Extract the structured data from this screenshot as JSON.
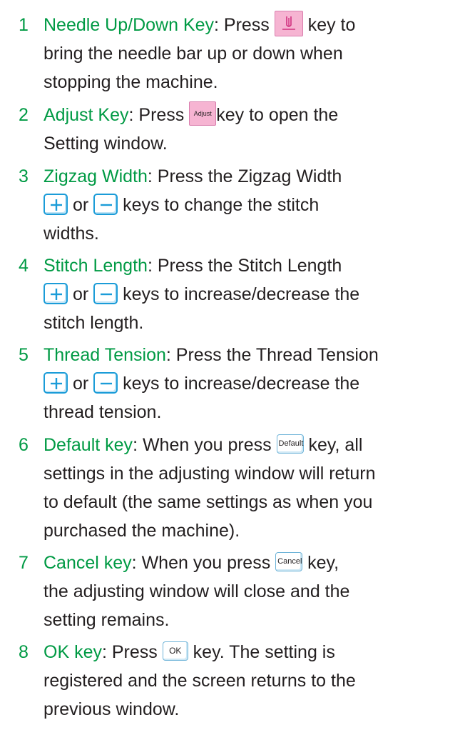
{
  "items": [
    {
      "number": "1",
      "term": "Needle Up/Down Key",
      "line1_pre": ": Press ",
      "line1_post": " key to",
      "line2": "bring the needle bar up or down when",
      "line3": "stopping the machine.",
      "key_icon": "needle-icon"
    },
    {
      "number": "2",
      "term": "Adjust Key",
      "line1_pre": ": Press ",
      "key_label": "Adjust",
      "line1_post": "key to open the",
      "line2": "Setting window."
    },
    {
      "number": "3",
      "term": "Zigzag Width",
      "line1_post": ": Press the Zigzag Width",
      "line2_mid": " or ",
      "line2_post": " keys to change the stitch",
      "line3": "widths.",
      "plus_icon": "plus-icon",
      "minus_icon": "minus-icon"
    },
    {
      "number": "4",
      "term": "Stitch Length",
      "line1_post": ": Press the Stitch Length",
      "line2_mid": " or ",
      "line2_post": " keys to increase/decrease the",
      "line3": "stitch length."
    },
    {
      "number": "5",
      "term": "Thread Tension",
      "line1_post": ": Press the Thread Tension",
      "line2_mid": " or ",
      "line2_post": " keys to increase/decrease the",
      "line3": "thread tension."
    },
    {
      "number": "6",
      "term": "Default key",
      "line1_pre": ": When you press ",
      "key_label": "Default",
      "line1_post": " key, all",
      "line2": "settings in the adjusting window will return",
      "line3": "to default (the same settings as when you",
      "line4": "purchased the machine)."
    },
    {
      "number": "7",
      "term": "Cancel key",
      "line1_pre": ": When you press ",
      "key_label": "Cancel",
      "line1_post": " key,",
      "line2": "the adjusting window will close and the",
      "line3": "setting remains."
    },
    {
      "number": "8",
      "term": "OK key",
      "line1_pre": ": Press ",
      "key_label": "OK",
      "line1_post": "  key. The setting is",
      "line2": "registered and the screen returns to the",
      "line3": "previous window."
    }
  ],
  "colors": {
    "term": "#009a44",
    "pink_key": "#f6b4d2",
    "blue_key_border": "#1b9cd8"
  }
}
